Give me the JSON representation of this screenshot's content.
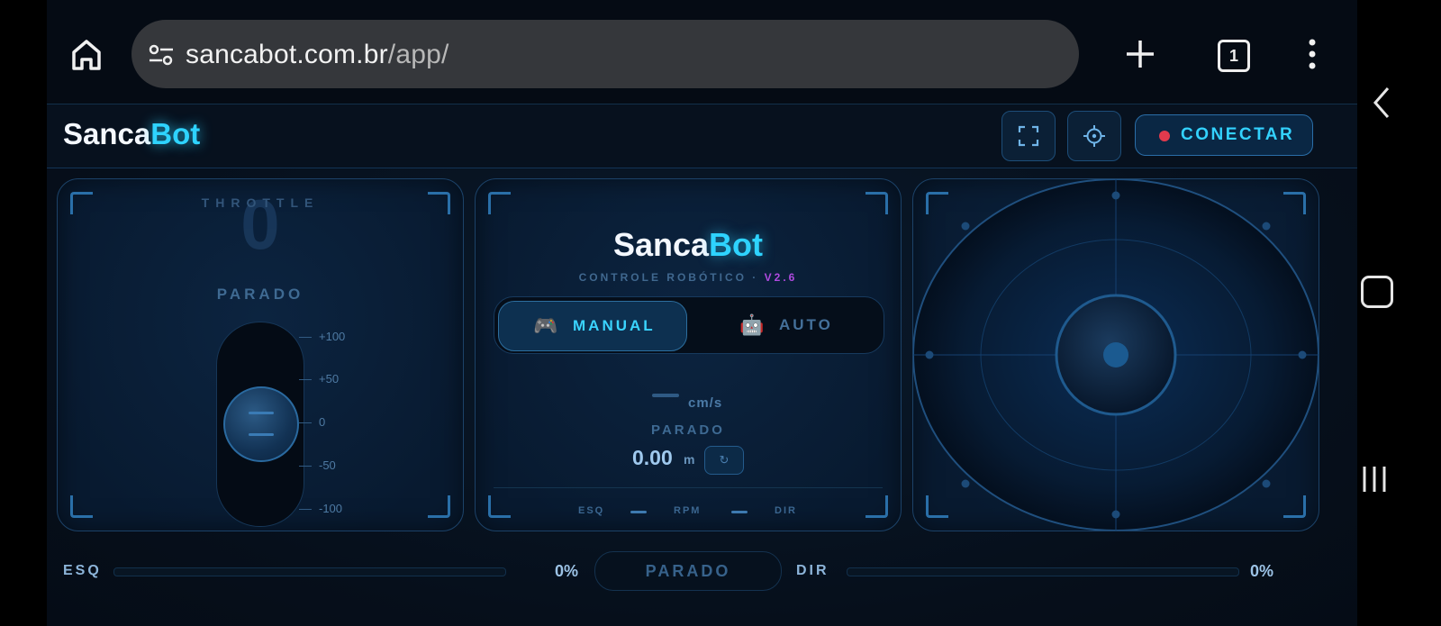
{
  "browser": {
    "url_domain": "sancabot.com.br",
    "url_path": "/app/",
    "tab_count": "1"
  },
  "header": {
    "logo_main": "Sanca",
    "logo_accent": "Bot",
    "connect_label": "CONECTAR"
  },
  "throttle": {
    "label": "THROTTLE",
    "value": "0",
    "status": "PARADO",
    "level": 0,
    "ticks": [
      "+100",
      "+50",
      "0",
      "-50",
      "-100"
    ]
  },
  "center": {
    "logo_main": "Sanca",
    "logo_accent": "Bot",
    "subtitle": "CONTROLE ROBÓTICO ·",
    "version": "V2.6",
    "mode_manual": "MANUAL",
    "mode_auto": "AUTO",
    "mode_manual_icon": "🎮",
    "mode_auto_icon": "🤖",
    "active_mode": "MANUAL",
    "speed_unit": "cm/s",
    "status": "PARADO",
    "distance": "0.00",
    "distance_unit": "m",
    "reset_icon": "↻",
    "left_label": "ESQ",
    "rpm_label": "RPM",
    "right_label": "DIR"
  },
  "bottom": {
    "left_label": "ESQ",
    "left_pct": "0%",
    "status": "PARADO",
    "right_label": "DIR",
    "right_pct": "0%"
  },
  "colors": {
    "accent": "#2ed3ff",
    "version": "#b04ae0",
    "connect_dot": "#e23a4d"
  },
  "icons": [
    "home-icon",
    "site-settings-icon",
    "plus-icon",
    "tabs-icon",
    "more-vert-icon",
    "fullscreen-icon",
    "crosshair-icon",
    "gamepad-icon",
    "robot-icon",
    "reset-icon",
    "back-icon",
    "home-nav-icon",
    "recents-icon"
  ]
}
